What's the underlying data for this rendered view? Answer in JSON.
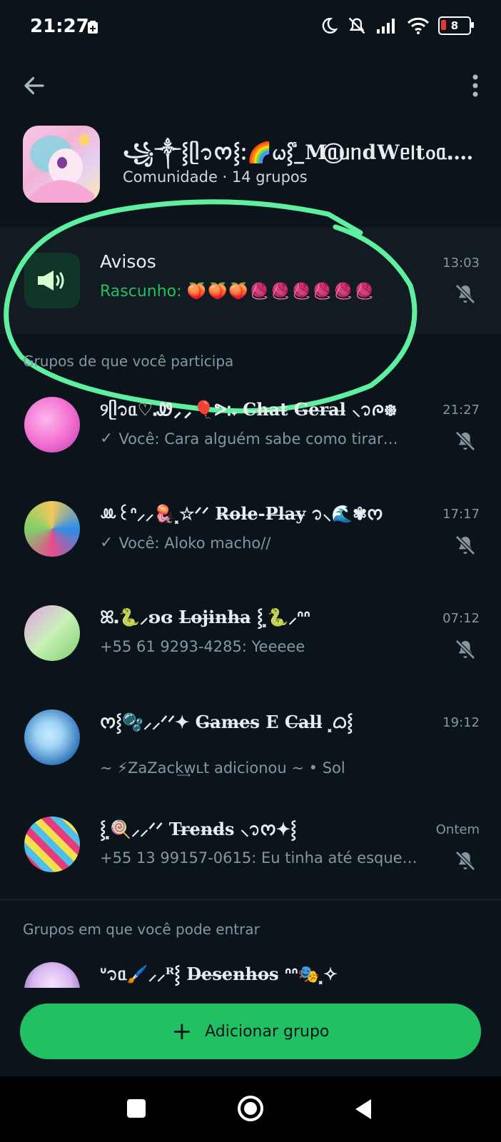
{
  "status_bar": {
    "time": "21:27",
    "battery": "8"
  },
  "community": {
    "name": "꧁⁠༒⸾⁠ᥫ᭡ᰔ⸾ᱺ⁠🌈⁠ᤐ⁠⸾⁠ᷛ⁠_Mᥲ⃝⁠ᥙ⁠ᥒdWᥱ𝗅t᧐ᥲ⸼⁠ᐟᐟ⸾⁠ᤐ",
    "subtitle": "Comunidade · 14 grupos"
  },
  "announcements": {
    "title": "Avisos",
    "draft_label": "Rascunho:",
    "draft_text": "🍑🍑🍑🧶🧶🧶🧶🧶🧶",
    "time": "13:03"
  },
  "sections": {
    "joined": "Grupos de que você participa",
    "available": "Grupos em que você pode entrar"
  },
  "groups": [
    {
      "name": "୨ᥫ᭡ᥲ♡⸼Ꮺ⸝⸝🎈⁠ᕗᱺ𝅄 C̶h̶a̶t̶ G̶e̶r̶a̶l̶ ⸜᭡ᰍ᪥",
      "message": "Você: Cara alguém sabe como tirar…",
      "time": "21:27",
      "sent": true,
      "color_a": "#f06dd0",
      "color_b": "#ffb6ee"
    },
    {
      "name": "ꔛ꒰ᐢ⸝⸝🪼⸼☆ᐟᐟ R̶o̶l̶e̶-P̶l̶a̶y̶ ᭡⸜🌊✾ᰔ",
      "message": "Você: Aloko macho//",
      "time": "17:17",
      "sent": true,
      "color_a": "#2c8ee8",
      "color_b": "#f3c85a"
    },
    {
      "name": "ꕤ⸼🐍⁠⸝⁠ʚ⁠ɞ⁠ L̶o̶j̶i̶n̶h̶a̶ ⸾⸼⁠🐍⸝ᐢᐢ",
      "message": "+55 61 9293-4285: Yeeeee",
      "time": "07:12",
      "sent": false,
      "color_a": "#7fd06b",
      "color_b": "#e6a0e8"
    },
    {
      "name": "ᰔ⸾🫧⸝⸝ᐟᐟ✦ G̶a̶m̶e̶s̶ E C̶a̶l̶l̶ ⸼⁠ᜊ⸾",
      "message": "~ ⚡ZaZack͢wʟt adicionou ~ • Sol",
      "time": "19:12",
      "sent": false,
      "color_a": "#2a6fb8",
      "color_b": "#9fd3f5"
    },
    {
      "name": "⸾⸼🍭⸝⸝ᐟᐟ Tr̶e̶n̶d̶s ⸜᭡ᰔ✦⸾",
      "message": "+55 13 99157-0615: Eu tinha até esque…",
      "time": "Ontem",
      "sent": false,
      "color_a": "#f2e14c",
      "color_b": "#e83c7a"
    },
    {
      "name": "ᐡ᭡ᥲ🖌️⸝⸝ᴿ⸾ D̶e̶s̶e̶n̶h̶o̶s̶ ᐢᐢ🎭⸼✧",
      "message": "",
      "time": "",
      "sent": false,
      "color_a": "#d8b6f0",
      "color_b": "#4d3a7a"
    }
  ],
  "add_group": "Adicionar grupo",
  "colors": {
    "background": "#0b141a",
    "accent": "#21c063",
    "annotation": "#5ef0a0"
  }
}
